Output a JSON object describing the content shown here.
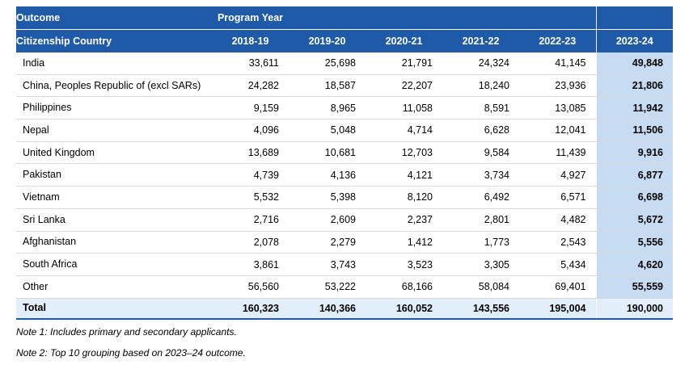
{
  "header": {
    "outcome_label": "Outcome",
    "program_year_label": "Program Year",
    "row_label": "Citizenship Country",
    "years": [
      "2018-19",
      "2019-20",
      "2020-21",
      "2021-22",
      "2022-23",
      "2023-24"
    ]
  },
  "rows": [
    {
      "country": "India",
      "values": [
        "33,611",
        "25,698",
        "21,791",
        "24,324",
        "41,145",
        "49,848"
      ]
    },
    {
      "country": "China, Peoples Republic of (excl SARs)",
      "values": [
        "24,282",
        "18,587",
        "22,207",
        "18,240",
        "23,936",
        "21,806"
      ]
    },
    {
      "country": "Philippines",
      "values": [
        "9,159",
        "8,965",
        "11,058",
        "8,591",
        "13,085",
        "11,942"
      ]
    },
    {
      "country": "Nepal",
      "values": [
        "4,096",
        "5,048",
        "4,714",
        "6,628",
        "12,041",
        "11,506"
      ]
    },
    {
      "country": "United Kingdom",
      "values": [
        "13,689",
        "10,681",
        "12,703",
        "9,584",
        "11,439",
        "9,916"
      ]
    },
    {
      "country": "Pakistan",
      "values": [
        "4,739",
        "4,136",
        "4,121",
        "3,734",
        "4,927",
        "6,877"
      ]
    },
    {
      "country": "Vietnam",
      "values": [
        "5,532",
        "5,398",
        "8,120",
        "6,492",
        "6,571",
        "6,698"
      ]
    },
    {
      "country": "Sri Lanka",
      "values": [
        "2,716",
        "2,609",
        "2,237",
        "2,801",
        "4,482",
        "5,672"
      ]
    },
    {
      "country": "Afghanistan",
      "values": [
        "2,078",
        "2,279",
        "1,412",
        "1,773",
        "2,543",
        "5,556"
      ]
    },
    {
      "country": "South Africa",
      "values": [
        "3,861",
        "3,743",
        "3,523",
        "3,305",
        "5,434",
        "4,620"
      ]
    },
    {
      "country": "Other",
      "values": [
        "56,560",
        "53,222",
        "68,166",
        "58,084",
        "69,401",
        "55,559"
      ]
    }
  ],
  "total": {
    "label": "Total",
    "values": [
      "160,323",
      "140,366",
      "160,052",
      "143,556",
      "195,004",
      "190,000"
    ]
  },
  "notes": [
    "Note 1: Includes primary and secondary applicants.",
    "Note 2: Top 10 grouping based on 2023–24 outcome."
  ],
  "colors": {
    "header_bg": "#1f5aa8",
    "highlight_col": "#c7dcf3",
    "total_bg": "#e2eef9"
  }
}
